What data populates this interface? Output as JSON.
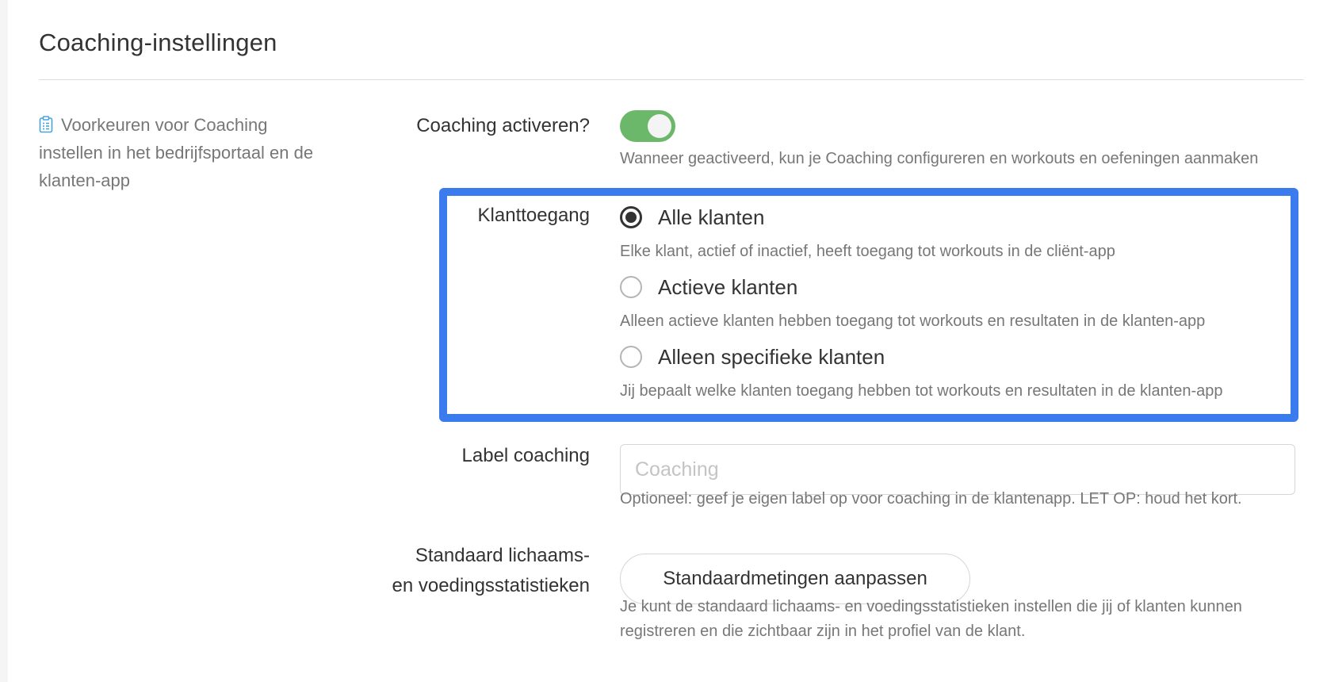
{
  "page": {
    "title": "Coaching-instellingen"
  },
  "sidebar": {
    "icon": "clipboard-icon",
    "description": "Voorkeuren voor Coaching instellen in het bedrijfsportaal en de klanten-app"
  },
  "coaching_toggle": {
    "label": "Coaching activeren?",
    "enabled": true,
    "help": "Wanneer geactiveerd, kun je Coaching configureren en workouts en oefeningen aanmaken"
  },
  "client_access": {
    "label": "Klanttoegang",
    "selected": "all",
    "options": [
      {
        "id": "all",
        "label": "Alle klanten",
        "help": "Elke klant, actief of inactief, heeft toegang tot workouts in de cliënt-app",
        "checked": true
      },
      {
        "id": "active",
        "label": "Actieve klanten",
        "help": "Alleen actieve klanten hebben toegang tot workouts en resultaten in de klanten-app",
        "checked": false
      },
      {
        "id": "specific",
        "label": "Alleen specifieke klanten",
        "help": "Jij bepaalt welke klanten toegang hebben tot workouts en resultaten in de klanten-app",
        "checked": false
      }
    ]
  },
  "label_coaching": {
    "label": "Label coaching",
    "value": "",
    "placeholder": "Coaching",
    "help": "Optioneel: geef je eigen label op voor coaching in de klantenapp. LET OP: houd het kort."
  },
  "default_stats": {
    "label_line1": "Standaard lichaams-",
    "label_line2": "en voedingsstatistieken",
    "button_label": "Standaardmetingen aanpassen",
    "help_line1": "Je kunt de standaard lichaams- en voedingsstatistieken instellen die jij of klanten kunnen",
    "help_line2": "registreren en die zichtbaar zijn in het profiel van de klant."
  },
  "colors": {
    "toggle_on": "#6bb86a",
    "highlight": "#3a7bee",
    "icon_accent": "#4aa3d8"
  }
}
